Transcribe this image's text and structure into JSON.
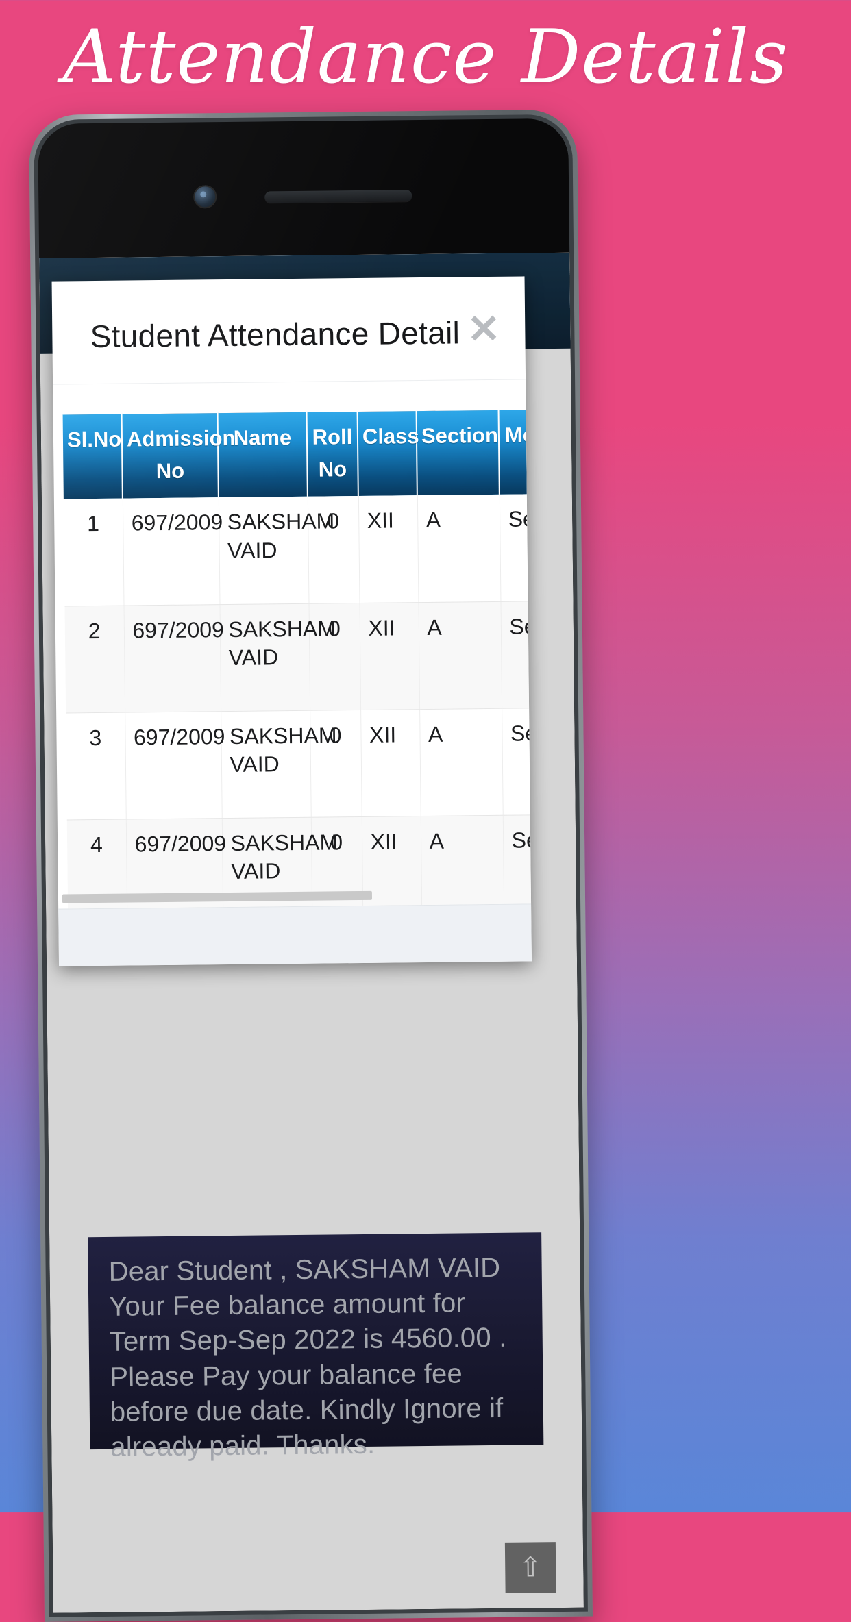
{
  "promo": {
    "title": "Attendance Details"
  },
  "phone": {
    "camera_icon": "camera-icon",
    "speaker_icon": "speaker-grille-icon"
  },
  "app": {
    "nav_items": [
      {
        "icon": "school-logo-icon"
      },
      {
        "icon": "student-photo-icon"
      },
      {
        "icon": "books-icon"
      },
      {
        "icon": "green-app-icon"
      }
    ],
    "message": "Dear Student , SAKSHAM VAID Your Fee balance amount for Term Sep-Sep 2022 is 4560.00 . Please Pay your balance fee before due date. Kindly Ignore if already paid. Thanks.",
    "scroll_top_icon": "⇧"
  },
  "modal": {
    "title": "Student Attendance Detail",
    "close_label": "✕",
    "table": {
      "columns": [
        "Sl.No",
        "Admission No",
        "Name",
        "Roll No",
        "Class",
        "Section",
        "Month Name"
      ],
      "rows": [
        {
          "sl_no": "1",
          "admission_no": "697/2009",
          "name": "SAKSHAM VAID",
          "roll_no": "0",
          "class": "XII",
          "section": "A",
          "month_name": "September"
        },
        {
          "sl_no": "2",
          "admission_no": "697/2009",
          "name": "SAKSHAM VAID",
          "roll_no": "0",
          "class": "XII",
          "section": "A",
          "month_name": "September"
        },
        {
          "sl_no": "3",
          "admission_no": "697/2009",
          "name": "SAKSHAM VAID",
          "roll_no": "0",
          "class": "XII",
          "section": "A",
          "month_name": "September"
        },
        {
          "sl_no": "4",
          "admission_no": "697/2009",
          "name": "SAKSHAM VAID",
          "roll_no": "0",
          "class": "XII",
          "section": "A",
          "month_name": "September"
        }
      ]
    }
  },
  "colors": {
    "bg_top": "#e8477f",
    "bg_bottom": "#5a86d8",
    "table_header_top": "#2ea7e8",
    "table_header_bottom": "#08395e",
    "message_bg": "#26264a"
  }
}
